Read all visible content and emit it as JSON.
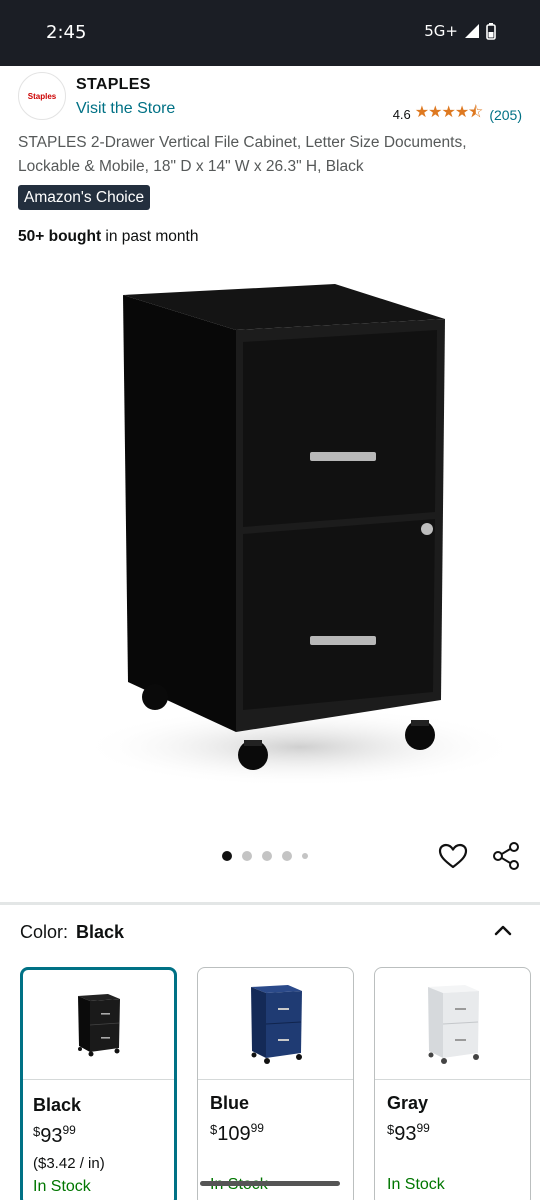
{
  "status_bar": {
    "time": "2:45",
    "network": "5G+"
  },
  "brand": {
    "logo_text": "Staples",
    "name": "STAPLES",
    "visit_store": "Visit the Store"
  },
  "rating": {
    "value": "4.6",
    "stars": "★★★★⯪",
    "count": "(205)"
  },
  "product": {
    "title": "STAPLES 2-Drawer Vertical File Cabinet, Letter Size Documents, Lockable & Mobile, 18\" D x 14\" W x 26.3\" H, Black",
    "badge": "Amazon's Choice",
    "bought_bold": "50+ bought",
    "bought_rest": " in past month"
  },
  "carousel": {
    "dot_count": 5,
    "active_index": 0
  },
  "icons": {
    "favorite": "heart-icon",
    "share": "share-icon",
    "collapse": "chevron-up-icon"
  },
  "variation": {
    "label": "Color:",
    "selected": "Black",
    "options": [
      {
        "name": "Black",
        "currency": "$",
        "price_whole": "93",
        "price_fraction": "99",
        "unit_price": "($3.42 / in)",
        "stock": "In Stock",
        "color": "#1a1a1a"
      },
      {
        "name": "Blue",
        "currency": "$",
        "price_whole": "109",
        "price_fraction": "99",
        "unit_price": "",
        "stock": "In Stock",
        "color": "#1f3b73"
      },
      {
        "name": "Gray",
        "currency": "$",
        "price_whole": "93",
        "price_fraction": "99",
        "unit_price": "",
        "stock": "In Stock",
        "color": "#e6e8ea"
      }
    ]
  },
  "colors": {
    "link": "#007185",
    "star": "#de7921",
    "stock": "#007600",
    "badge_bg": "#232f3e",
    "selected_border": "#007185"
  }
}
